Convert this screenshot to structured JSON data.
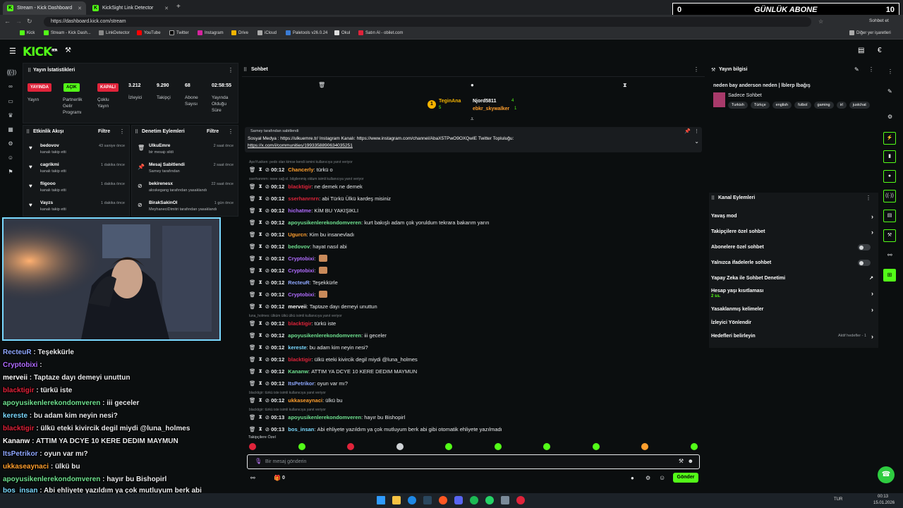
{
  "browser": {
    "tabs": [
      {
        "label": "Stream - Kick Dashboard",
        "active": true
      },
      {
        "label": "KickSight Link Detector",
        "active": false
      }
    ],
    "url": "https://dashboard.kick.com/stream",
    "bookmarks": [
      "Kick",
      "Stream - Kick Dash...",
      "LinkDetector",
      "YouTube",
      "Twitter",
      "Instagram",
      "Drive",
      "iCloud",
      "Paletools v26.0.24",
      "Okul",
      "Satın Al - obilet.com"
    ],
    "other_bookmarks": "Diğer yer işaretleri",
    "profile_label": "Sohbet et"
  },
  "sub_overlay": {
    "left_value": "0",
    "label": "GÜNLÜK ABONE",
    "right_value": "10"
  },
  "kick": {
    "logo": "KICK",
    "logo_sup": "BETA"
  },
  "stats": {
    "title": "Yayın İstatistikleri",
    "badges": [
      {
        "text": "YAYINDA",
        "color": "#e0233a",
        "label": "Yayın"
      },
      {
        "text": "AÇIK",
        "color": "#53fc18",
        "label": "Partnerlik Gelir Programı"
      },
      {
        "text": "KAPALI",
        "color": "#e0233a",
        "label": "Çoklu Yayın"
      }
    ],
    "values": [
      {
        "value": "3.212",
        "label": "İzleyici"
      },
      {
        "value": "9.290",
        "label": "Takipçi"
      },
      {
        "value": "68",
        "label": "Abone Sayısı"
      },
      {
        "value": "02:58:55",
        "label": "Yayında Olduğu Süre"
      }
    ]
  },
  "activity": {
    "title": "Etkinlik Akışı",
    "filter": "Filtre",
    "items": [
      {
        "name": "bedovov",
        "sub": "kanalı takip etti",
        "time": "43 saniye önce"
      },
      {
        "name": "cagrikmi",
        "sub": "kanalı takip etti",
        "time": "1 dakika önce"
      },
      {
        "name": "fligooo",
        "sub": "kanalı takip etti",
        "time": "1 dakika önce"
      },
      {
        "name": "Vayzs",
        "sub": "kanalı takip etti",
        "time": "1 dakika önce"
      }
    ]
  },
  "moderation": {
    "title": "Denetim Eylemleri",
    "filter": "Filtre",
    "items": [
      {
        "name": "UlkuEmre",
        "sub": "bir mesajı sildi",
        "time": "2 saat önce"
      },
      {
        "name": "Mesaj Sabitlendi",
        "sub": "Sarney tarafından",
        "time": "2 saat önce"
      },
      {
        "name": "bekirenesx",
        "sub": "aloskegang tarafından yasaklandı",
        "time": "22 saat önce"
      },
      {
        "name": "BirakSakinOl",
        "sub": "MeyhaneciDimitri tarafından yasaklandı",
        "time": "1 gün önce"
      }
    ]
  },
  "overlay_chat": [
    {
      "user": "RecteuR",
      "text": "Teşekkürle",
      "color": "#8fa8ff"
    },
    {
      "user": "Cryptobixi",
      "text": "",
      "color": "#b06cff"
    },
    {
      "user": "merveii",
      "text": "Taptaze dayı demeyi unuttun",
      "color": "#ffffff"
    },
    {
      "user": "blacktigir",
      "text": "türkü iste",
      "color": "#e0233a"
    },
    {
      "user": "apoyusikenlerekondomveren",
      "text": "iii geceler",
      "color": "#6ee08f"
    },
    {
      "user": "kereste",
      "text": "bu adam kim neyin nesi?",
      "color": "#7ad9ff"
    },
    {
      "user": "blacktigir",
      "text": "ülkü eteki kivircik degil miydi @luna_holmes",
      "color": "#e0233a"
    },
    {
      "user": "Kananw",
      "text": "ATTIM YA DCYE 10 KERE DEDIM MAYMUN",
      "color": "#ffffff"
    },
    {
      "user": "ItsPetrikor",
      "text": "oyun var mı?",
      "color": "#8fa8ff"
    },
    {
      "user": "ukkaseaynaci",
      "text": "ülkü bu",
      "color": "#ff9f2e"
    },
    {
      "user": "apoyusikenlerekondomveren",
      "text": "hayır bu Bishopirl",
      "color": "#6ee08f"
    },
    {
      "user": "bos_insan",
      "text": "Abi ehliyete yazıldım ya çok mutluyum berk abi gibi otomatik ehliyete yazılmadı",
      "color": "#7ad9ff"
    }
  ],
  "chat": {
    "title": "Sohbet",
    "top_gifters": [
      {
        "name": "TeginAna",
        "count": "5"
      },
      {
        "name": "Njord5811",
        "count": "4"
      },
      {
        "name": "ebkr_skywalker",
        "count": "1"
      }
    ],
    "pinned": {
      "by": "Sarney tarafından sabitlendi",
      "line1": "Sosyal Medya : https://ulkuemre.tr/ Instagram Kanalı: https://www.instagram.com/channel/AbaX5TPwO9OXQwIE Twitter Topluluğu:",
      "line2": "https://x.com/i/communities/1993358890634035251"
    },
    "messages": [
      {
        "time": "00:12",
        "user": "Chancerly",
        "color": "#ff9f2e",
        "text": "türkü o",
        "reply": "ApoYusiken: pedo olan kimse kendi ismini kullanıcıya yanıt veriyor"
      },
      {
        "time": "00:12",
        "user": "blacktigir",
        "color": "#e0233a",
        "text": "ne demek ne demek",
        "reply": "sserhanrnrn: neee sağ ol. bilgilenmiş oldum isimli kullanıcıya yanıt veriyor"
      },
      {
        "time": "00:12",
        "user": "sserhanrnrn",
        "color": "#e0233a",
        "text": "abi Türkü Ülkü kardeş misiniz",
        "reply": ""
      },
      {
        "time": "00:12",
        "user": "hichatme",
        "color": "#b06cff",
        "text": "KİM BU YAKIŞIKLI",
        "reply": ""
      },
      {
        "time": "00:12",
        "user": "apoyusikenlerekondomveren",
        "color": "#6ee08f",
        "text": "kurt bakışlı adam çok yoruldum tekrara bakarım yarın",
        "reply": ""
      },
      {
        "time": "00:12",
        "user": "Ugurcn",
        "color": "#ff9f2e",
        "text": "Kim bu insanevladı",
        "reply": ""
      },
      {
        "time": "00:12",
        "user": "bedovov",
        "color": "#6ee08f",
        "text": "hayat nasıl abi",
        "reply": ""
      },
      {
        "time": "00:12",
        "user": "Cryptobixi",
        "color": "#b06cff",
        "text": "",
        "reply": ""
      },
      {
        "time": "00:12",
        "user": "Cryptobixi",
        "color": "#b06cff",
        "text": "",
        "reply": ""
      },
      {
        "time": "00:12",
        "user": "RecteuR",
        "color": "#8fa8ff",
        "text": "Teşekkürle",
        "reply": ""
      },
      {
        "time": "00:12",
        "user": "Cryptobixi",
        "color": "#b06cff",
        "text": "",
        "reply": ""
      },
      {
        "time": "00:12",
        "user": "merveii",
        "color": "#ffffff",
        "text": "Taptaze dayı demeyi unuttun",
        "reply": ""
      },
      {
        "time": "00:12",
        "user": "blacktigir",
        "color": "#e0233a",
        "text": "türkü iste",
        "reply": "luna_holmes: ülküm ülkü ülkü isimli kullanıcıya yanıt veriyor"
      },
      {
        "time": "00:12",
        "user": "apoyusikenlerekondomveren",
        "color": "#6ee08f",
        "text": "iii geceler",
        "reply": ""
      },
      {
        "time": "00:12",
        "user": "kereste",
        "color": "#7ad9ff",
        "text": "bu adam kim neyin nesi?",
        "reply": ""
      },
      {
        "time": "00:12",
        "user": "blacktigir",
        "color": "#e0233a",
        "text": "ülkü eteki kivircik degil miydi @luna_holmes",
        "reply": ""
      },
      {
        "time": "00:12",
        "user": "Kananw",
        "color": "#6ee08f",
        "text": "ATTIM YA DCYE 10 KERE DEDIM MAYMUN",
        "reply": ""
      },
      {
        "time": "00:12",
        "user": "ItsPetrikor",
        "color": "#8fa8ff",
        "text": "oyun var mı?",
        "reply": ""
      },
      {
        "time": "00:12",
        "user": "ukkaseaynaci",
        "color": "#ff9f2e",
        "text": "ülkü bu",
        "reply": "blacktigir: türkü iste isimli kullanıcıya yanıt veriyor"
      },
      {
        "time": "00:13",
        "user": "apoyusikenlerekondomveren",
        "color": "#6ee08f",
        "text": "hayır bu Bishopirl",
        "reply": "blacktigir: türkü iste isimli kullanıcıya yanıt veriyor"
      },
      {
        "time": "00:13",
        "user": "bos_insan",
        "color": "#7ad9ff",
        "text": "Abi ehliyete yazıldım ya çok mutluyum berk abi gibi otomatik ehliyete yazılmadı",
        "reply": ""
      }
    ],
    "followers_only": "Takipçilere Özel",
    "input_placeholder": "Bir mesaj gönderin",
    "points": "0",
    "send": "Gönder"
  },
  "stream_info": {
    "title": "Yayın bilgisi",
    "stream_title": "neden bay anderson neden | lblerp lbağış",
    "category": "Sadece Sohbet",
    "tags": [
      "Turkish",
      "Türkçe",
      "english",
      "futbol",
      "gaming",
      "irl",
      "justchat"
    ]
  },
  "channel_actions": {
    "title": "Kanal Eylemleri",
    "items": [
      {
        "label": "Yavaş mod",
        "kind": "arrow"
      },
      {
        "label": "Takipçilere özel sohbet",
        "kind": "arrow"
      },
      {
        "label": "Abonelere özel sohbet",
        "kind": "toggle"
      },
      {
        "label": "Yalnızca ifadelerle sohbet",
        "kind": "toggle"
      },
      {
        "label": "Yapay Zeka ile Sohbet Denetimi",
        "kind": "link"
      },
      {
        "label": "Hesap yaşı kısıtlaması",
        "kind": "arrow",
        "sub": "2 ss."
      },
      {
        "label": "Yasaklanmış kelimeler",
        "kind": "arrow"
      },
      {
        "label": "İzleyici Yönlendir",
        "kind": "none"
      },
      {
        "label": "Hedefleri belirleyin",
        "kind": "arrow",
        "note": "Aktif hedefler - 1"
      }
    ]
  },
  "taskbar": {
    "lang": "TUR",
    "time": "00:13",
    "date": "15.01.2026"
  },
  "colors": {
    "accent": "#53fc18",
    "live": "#e0233a",
    "bg": "#0b0e0f",
    "panel": "#141719"
  }
}
